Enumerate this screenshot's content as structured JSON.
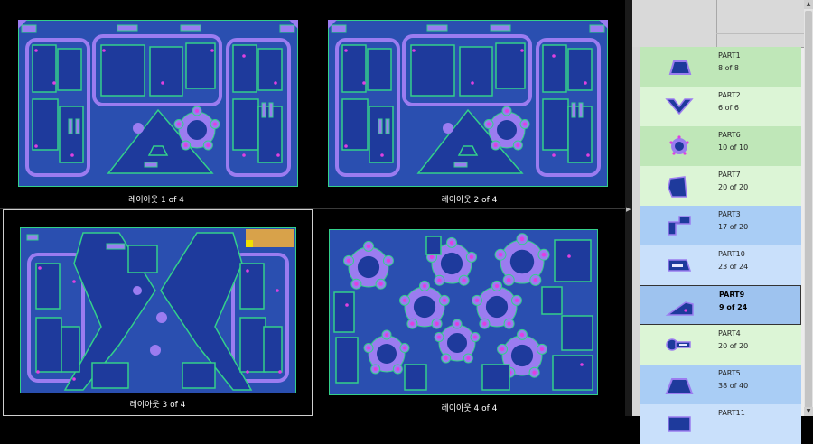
{
  "layouts": [
    {
      "caption": "레이아웃 1 of 4"
    },
    {
      "caption": "레이아웃 2 of 4"
    },
    {
      "caption": "레이아웃 3 of 4"
    },
    {
      "caption": "레이아웃 4 of 4"
    }
  ],
  "parts": [
    {
      "name": "PART1",
      "count": "8 of 8",
      "icon": "trapezoid-part-icon"
    },
    {
      "name": "PART2",
      "count": "6 of 6",
      "icon": "chevron-part-icon"
    },
    {
      "name": "PART6",
      "count": "10 of 10",
      "icon": "flange-ring-part-icon"
    },
    {
      "name": "PART7",
      "count": "20 of 20",
      "icon": "quad-plate-part-icon"
    },
    {
      "name": "PART3",
      "count": "17 of 20",
      "icon": "l-bracket-part-icon"
    },
    {
      "name": "PART10",
      "count": "23 of 24",
      "icon": "slotted-plate-part-icon"
    },
    {
      "name": "PART9",
      "count": "9 of 24",
      "icon": "ramp-part-icon"
    },
    {
      "name": "PART4",
      "count": "20 of 20",
      "icon": "key-part-icon"
    },
    {
      "name": "PART5",
      "count": "38 of 40",
      "icon": "trapezoid-plate-part-icon"
    },
    {
      "name": "PART11",
      "count": "",
      "icon": "plate-part-icon"
    }
  ],
  "colors": {
    "sheet": "#2a4fb0",
    "outline": "#33d08a",
    "part_fill": "#1e3a9c",
    "part_outline": "#9b7cf0",
    "hole": "#e040e0",
    "row_green": "#bfe7b8",
    "row_green_light": "#dcf5d6",
    "row_blue": "#a9cdf5",
    "row_blue_light": "#c9e0fb",
    "row_selected": "#9ec3ef"
  }
}
